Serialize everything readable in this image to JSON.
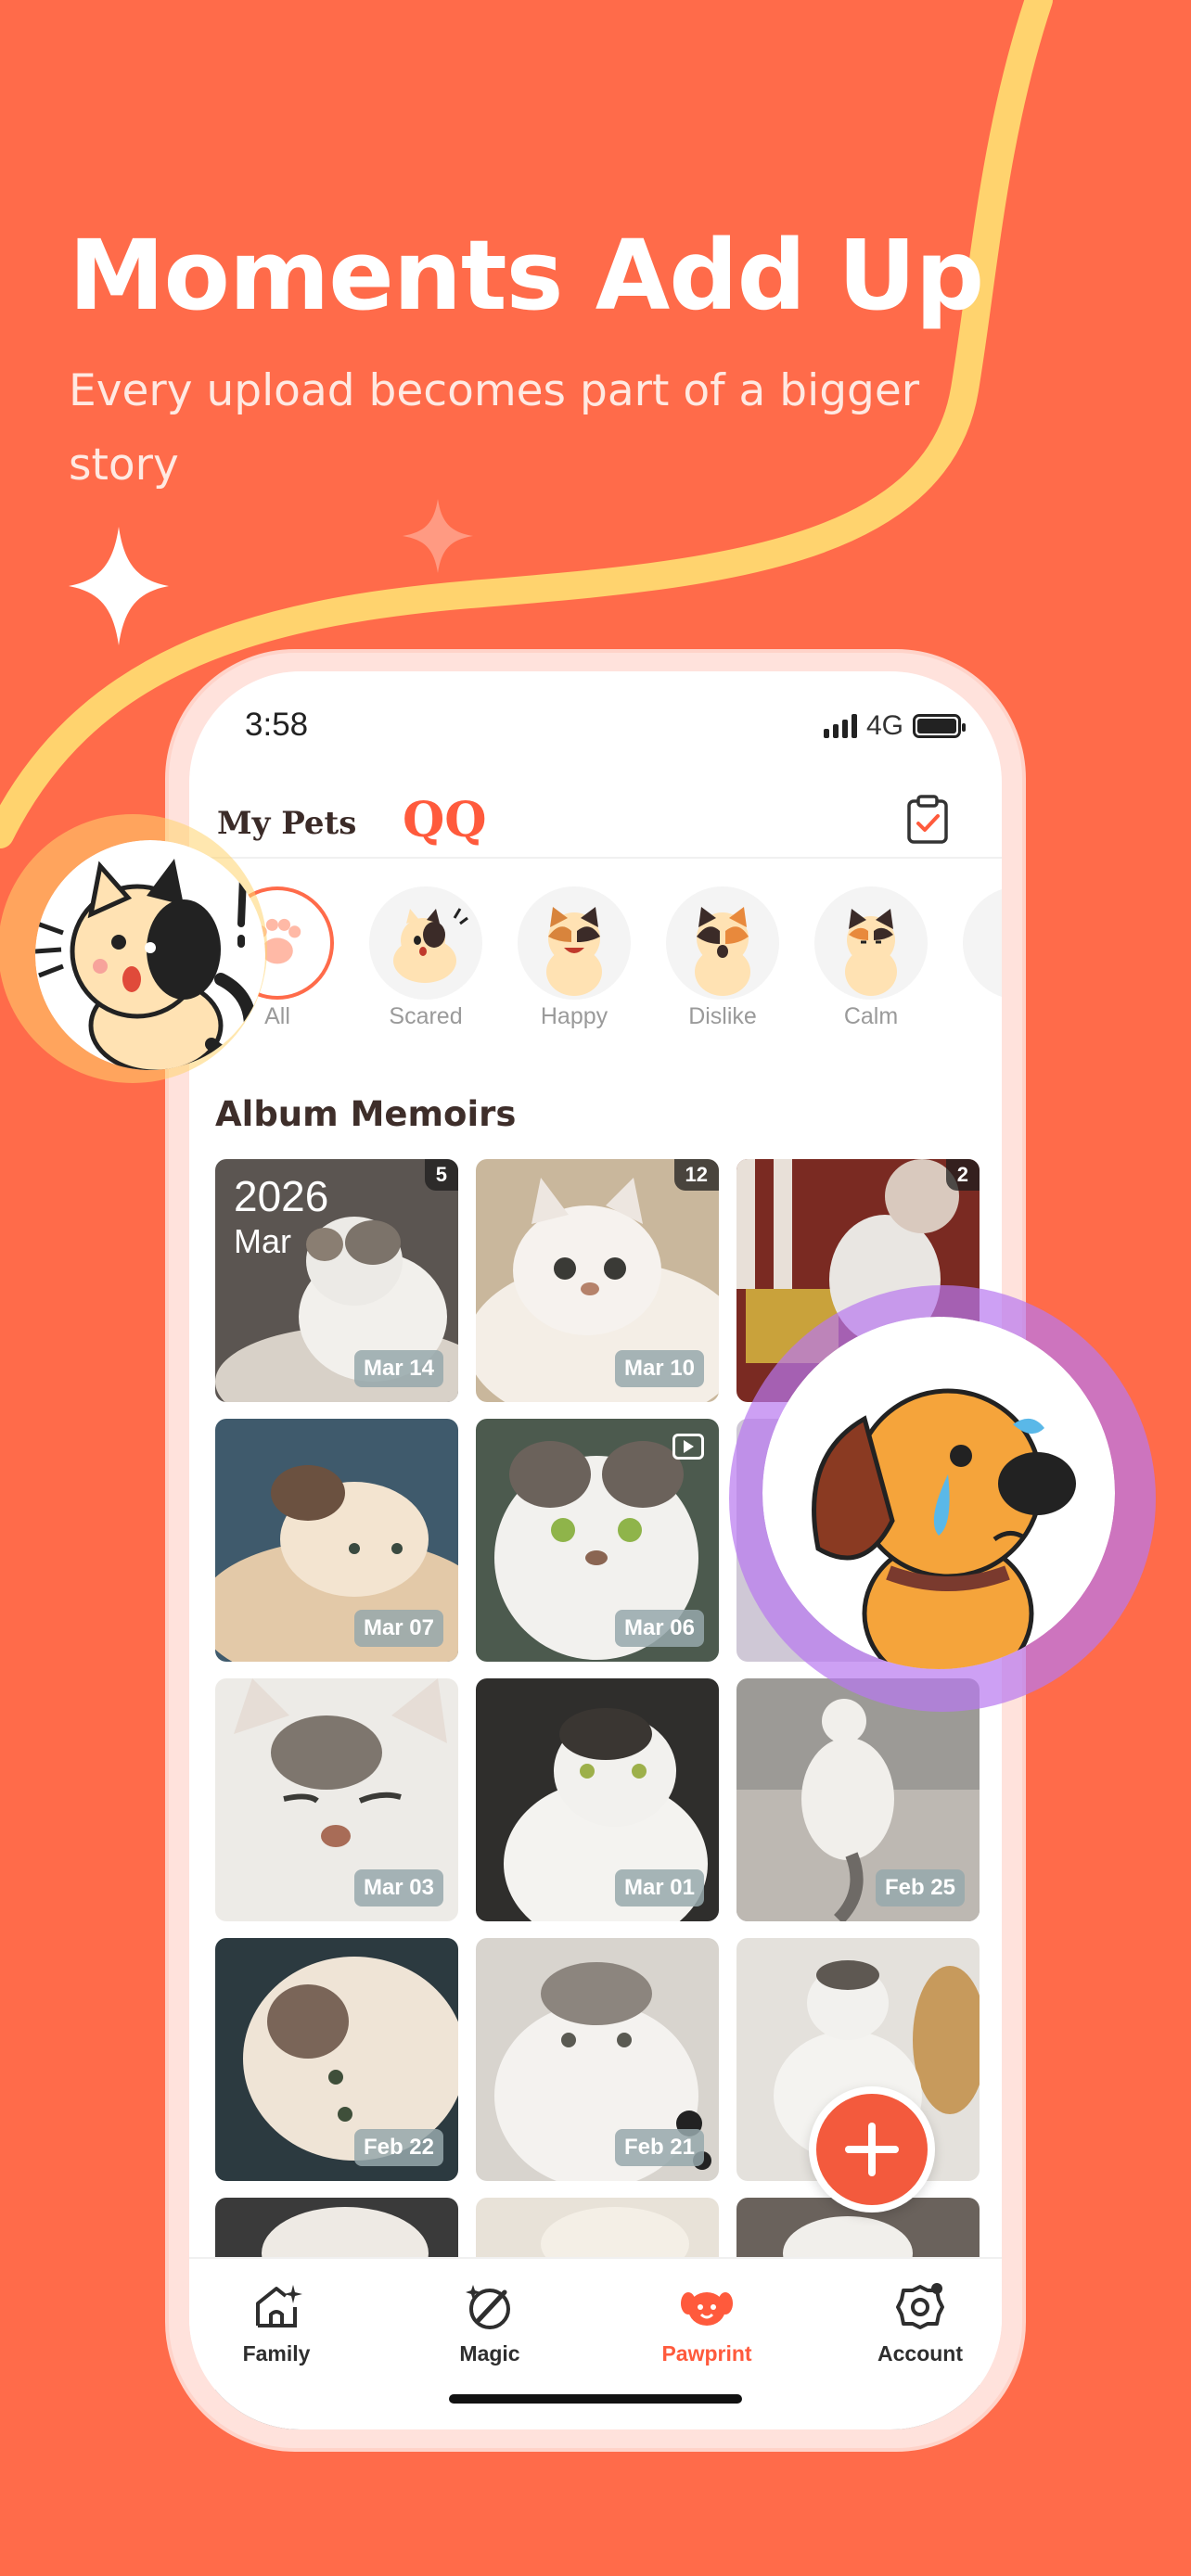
{
  "hero": {
    "title": "Moments Add Up",
    "subtitle": "Every upload becomes part of a bigger story"
  },
  "colors": {
    "background": "#FF6B4A",
    "accent_stripe": "#FFD36E",
    "brand": "#FF5A3C"
  },
  "status_bar": {
    "time": "3:58",
    "network": "4G"
  },
  "header": {
    "section_label": "My Pets",
    "pet_name": "QQ",
    "action_icon": "clipboard-check-icon"
  },
  "moods": [
    {
      "label": "All",
      "active": true
    },
    {
      "label": "Scared"
    },
    {
      "label": "Happy"
    },
    {
      "label": "Dislike"
    },
    {
      "label": "Calm"
    }
  ],
  "album": {
    "title": "Album Memoirs",
    "tiles": [
      {
        "year": "2026",
        "month": "Mar",
        "count": "5",
        "date": "Mar 14"
      },
      {
        "count": "12",
        "date": "Mar 10"
      },
      {
        "count": "2"
      },
      {
        "date": "Mar 07"
      },
      {
        "date": "Mar 06",
        "video": true
      },
      {},
      {
        "date": "Mar 03"
      },
      {
        "date": "Mar 01"
      },
      {
        "date": "Feb 25"
      },
      {
        "date": "Feb 22"
      },
      {
        "date": "Feb 21"
      },
      {}
    ]
  },
  "tabs": [
    {
      "label": "Family",
      "icon": "home-sparkle-icon"
    },
    {
      "label": "Magic",
      "icon": "magic-wand-icon"
    },
    {
      "label": "Pawprint",
      "icon": "dog-face-icon",
      "active": true
    },
    {
      "label": "Account",
      "icon": "account-gear-icon"
    }
  ],
  "fab": {
    "icon": "plus-icon"
  }
}
